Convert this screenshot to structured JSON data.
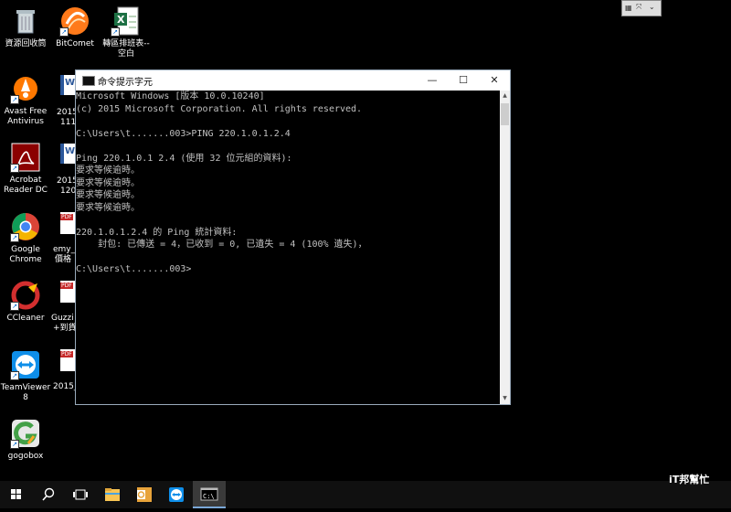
{
  "desktop": {
    "icons": [
      {
        "label": "資源回收筒"
      },
      {
        "label": "BitComet"
      },
      {
        "label": "轉區排班表--空白"
      },
      {
        "label": "Avast Free Antivirus"
      },
      {
        "label": "Acrobat Reader DC"
      },
      {
        "label": "Google Chrome"
      },
      {
        "label": "CCleaner"
      },
      {
        "label": "TeamViewer 8"
      },
      {
        "label": "gogobox"
      }
    ],
    "partial_labels": [
      "2015",
      "111",
      "2015",
      "120",
      "emy_",
      "價格",
      "Guzzi",
      "+到貨",
      "2015_"
    ],
    "pdf_badge": "PDF"
  },
  "console": {
    "title": "命令提示字元",
    "minimize_glyph": "—",
    "maximize_glyph": "☐",
    "close_glyph": "✕",
    "lines": [
      "Microsoft Windows [版本 10.0.10240]",
      "(c) 2015 Microsoft Corporation. All rights reserved.",
      "",
      "C:\\Users\\t.......003>PING 220.1.0.1.2.4",
      "",
      "Ping 220.1.0.1 2.4 (使用 32 位元組的資料):",
      "要求等候逾時。",
      "要求等候逾時。",
      "要求等候逾時。",
      "要求等候逾時。",
      "",
      "220.1.0.1.2.4 的 Ping 統計資料:",
      "    封包: 已傳送 = 4，已收到 = 0, 已遺失 = 4 (100% 遺失)，",
      "",
      "C:\\Users\\t.......003>"
    ]
  },
  "taskbar": {
    "items": [
      "start",
      "search",
      "task-view",
      "file-explorer",
      "outlook",
      "teamviewer",
      "command-prompt"
    ],
    "active": "command-prompt"
  },
  "watermark": "iT邦幫忙",
  "colors": {
    "console_text": "#c0c0c0",
    "desktop_bg": "#000000",
    "taskbar_bg": "#101010"
  }
}
